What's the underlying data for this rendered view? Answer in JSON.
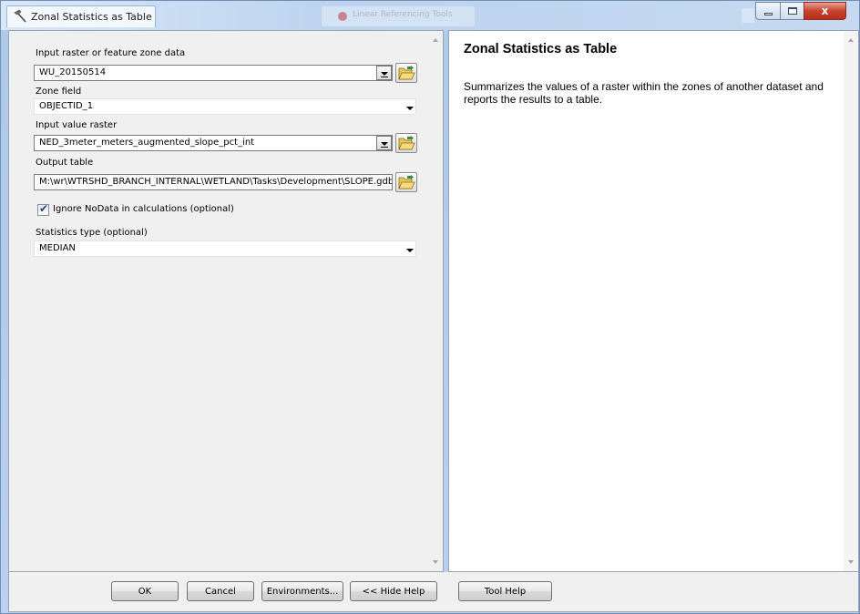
{
  "window": {
    "title": "Zonal Statistics as Table",
    "background_tab_text": "Linear Referencing Tools",
    "close_glyph": "x"
  },
  "form": {
    "input_raster": {
      "label": "Input raster or feature zone data",
      "value": "WU_20150514"
    },
    "zone_field": {
      "label": "Zone field",
      "value": "OBJECTID_1"
    },
    "value_raster": {
      "label": "Input value raster",
      "value": "NED_3meter_meters_augmented_slope_pct_int"
    },
    "output_table": {
      "label": "Output table",
      "value": "M:\\wr\\WTRSHD_BRANCH_INTERNAL\\WETLAND\\Tasks\\Development\\SLOPE.gdb"
    },
    "ignore_nodata": {
      "label": "Ignore NoData in calculations (optional)",
      "checked": true
    },
    "statistics_type": {
      "label": "Statistics type (optional)",
      "value": "MEDIAN"
    }
  },
  "help": {
    "title": "Zonal Statistics as Table",
    "description": "Summarizes the values of a raster within the zones of another dataset and reports the results to a table."
  },
  "buttons": {
    "ok": "OK",
    "cancel": "Cancel",
    "environments": "Environments...",
    "hide_help": "<< Hide Help",
    "tool_help": "Tool Help"
  },
  "colors": {
    "title_bar": "#c6d9f1",
    "close_button": "#c7432d",
    "panel": "#f0f0f0"
  }
}
